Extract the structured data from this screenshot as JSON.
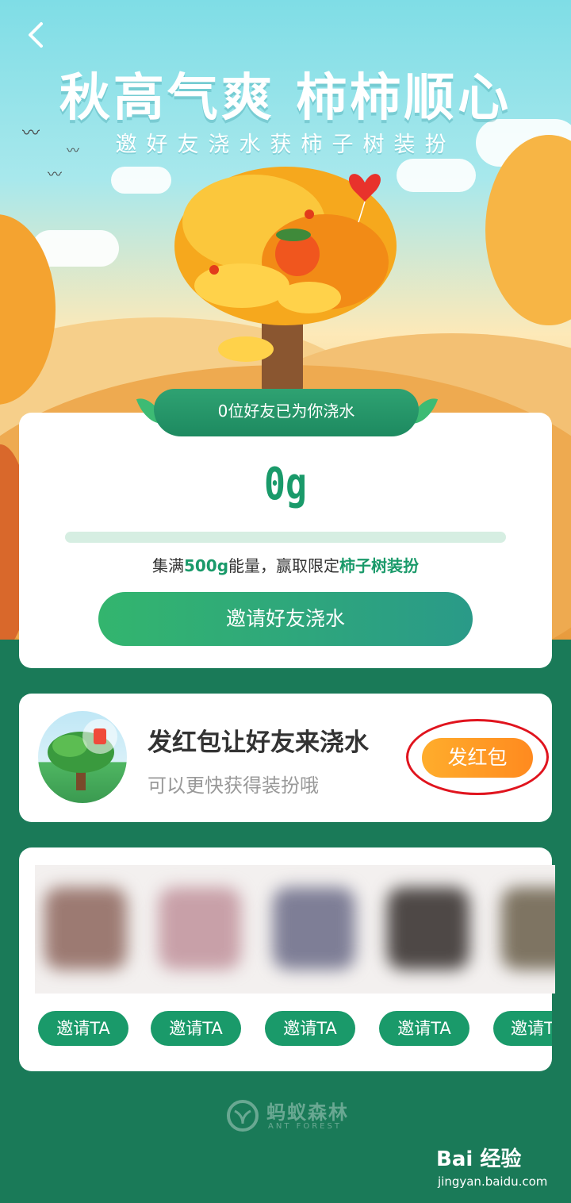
{
  "hero": {
    "title": "秋高气爽 柿柿顺心",
    "subtitle": "邀好友浇水获柿子树装扮"
  },
  "progress_card": {
    "ribbon_text": "0位好友已为你浇水",
    "energy_amount": "0g",
    "progress_fraction": 0,
    "goal_prefix": "集满",
    "goal_amount": "500g",
    "goal_middle": "能量，赢取限定",
    "goal_reward": "柿子树装扮",
    "invite_button": "邀请好友浇水"
  },
  "red_packet_card": {
    "title": "发红包让好友来浇水",
    "subtitle": "可以更快获得装扮哦",
    "button": "发红包"
  },
  "friends": {
    "invite_labels": [
      "邀请TA",
      "邀请TA",
      "邀请TA",
      "邀请TA",
      "邀请TA"
    ]
  },
  "footer": {
    "brand": "蚂蚁森林",
    "brand_en": "ANT FOREST"
  },
  "watermark": {
    "text": "Bai 经验",
    "url": "jingyan.baidu.com"
  },
  "colors": {
    "primary_green": "#1a9a6a",
    "orange_button": "#ff8a1f",
    "highlight_circle": "#e0141e"
  }
}
